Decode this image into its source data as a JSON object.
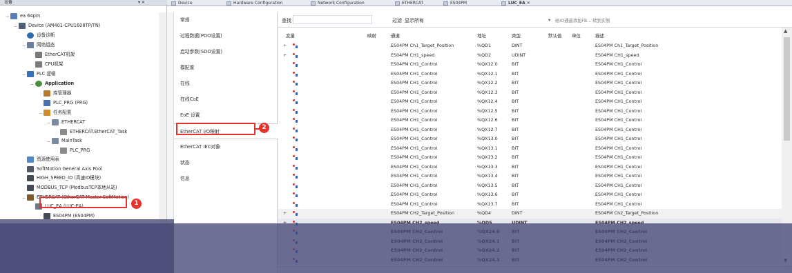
{
  "tree": {
    "header_title": "设备",
    "header_controls": "▾ ✕",
    "rows": [
      {
        "label": "ea 64pm",
        "indent": 0,
        "icon": "project-icon",
        "exp": "−",
        "bold": false
      },
      {
        "label": "Device (AM401-CPU1608TP/TN)",
        "indent": 1,
        "icon": "device-icon",
        "exp": "−",
        "bold": false
      },
      {
        "label": "设备诊断",
        "indent": 2,
        "icon": "diagnosis-icon",
        "exp": "",
        "bold": false
      },
      {
        "label": "网络组态",
        "indent": 2,
        "icon": "network-icon",
        "exp": "−",
        "bold": false
      },
      {
        "label": "EtherCAT机架",
        "indent": 3,
        "icon": "rack-icon",
        "exp": "",
        "bold": false
      },
      {
        "label": "CPU机架",
        "indent": 3,
        "icon": "rack-icon",
        "exp": "",
        "bold": false
      },
      {
        "label": "PLC 逻辑",
        "indent": 2,
        "icon": "plc-logic-icon",
        "exp": "−",
        "bold": false
      },
      {
        "label": "Application",
        "indent": 3,
        "icon": "application-icon",
        "exp": "−",
        "bold": true
      },
      {
        "label": "库管理器",
        "indent": 4,
        "icon": "library-icon",
        "exp": "",
        "bold": false
      },
      {
        "label": "PLC_PRG (PRG)",
        "indent": 4,
        "icon": "program-icon",
        "exp": "",
        "bold": false
      },
      {
        "label": "任务配置",
        "indent": 4,
        "icon": "task-config-icon",
        "exp": "−",
        "bold": false
      },
      {
        "label": "ETHERCAT",
        "indent": 5,
        "icon": "task-icon",
        "exp": "−",
        "bold": false
      },
      {
        "label": "ETHERCAT.EtherCAT_Task",
        "indent": 6,
        "icon": "task-call-icon",
        "exp": "",
        "bold": false
      },
      {
        "label": "MainTask",
        "indent": 5,
        "icon": "task-icon",
        "exp": "−",
        "bold": false
      },
      {
        "label": "PLC_PRG",
        "indent": 6,
        "icon": "task-call-icon",
        "exp": "",
        "bold": false
      },
      {
        "label": "资源使用表",
        "indent": 2,
        "icon": "resource-icon",
        "exp": "",
        "bold": false
      },
      {
        "label": "SoftMotion General Axis Pool",
        "indent": 2,
        "icon": "axis-pool-icon",
        "exp": "",
        "bold": false
      },
      {
        "label": "HIGH_SPEED_IO (高速IO模块)",
        "indent": 2,
        "icon": "module-icon",
        "exp": "",
        "bold": false
      },
      {
        "label": "MODBUS_TCP (ModbusTCP本地从站)",
        "indent": 2,
        "icon": "module-icon",
        "exp": "",
        "bold": false
      },
      {
        "label": "ETHERCAT (EtherCAT Master SoftMotion)",
        "indent": 2,
        "icon": "ethercat-master-icon",
        "exp": "−",
        "bold": false
      },
      {
        "label": "LUC_EA (LUC-EA)",
        "indent": 3,
        "icon": "slave-icon",
        "exp": "",
        "bold": false
      },
      {
        "label": "ES04PM (ES04PM)",
        "indent": 4,
        "icon": "module-icon",
        "exp": "",
        "bold": false
      }
    ]
  },
  "editor_tabs": [
    {
      "label": "Device",
      "active": false
    },
    {
      "label": "Hardware Configuration",
      "active": false
    },
    {
      "label": "Network Configuration",
      "active": false
    },
    {
      "label": "ETHERCAT",
      "active": false
    },
    {
      "label": "ES04PM",
      "active": false
    },
    {
      "label": "LUC_EA",
      "active": true
    }
  ],
  "nav": {
    "items": [
      "常规",
      "过程数据(PDO设置)",
      "启动参数(SDO设置)",
      "模配置",
      "在线",
      "在线CoE",
      "EoE 设置",
      "EtherCAT I/O映射",
      "EtherCAT IEC对象",
      "状态",
      "信息"
    ],
    "selected_index": 7
  },
  "toolbar": {
    "find_label": "查找",
    "filter_label": "过滤",
    "filter_value": "显示所有",
    "add_fb_hint": "给IO通道添加FB... 转到实例"
  },
  "columns": {
    "variable": "变量",
    "mapping": "映射",
    "channel": "通道",
    "address": "地址",
    "type": "类型",
    "default": "默认值",
    "unit": "单位",
    "description": "描述"
  },
  "rows": [
    {
      "exp": "+",
      "channel": "ES04PM Ch1_Target_Position",
      "address": "%QD1",
      "type": "DINT",
      "desc": "ES04PM Ch1_Target_Position"
    },
    {
      "exp": "+",
      "channel": "ES04PM CH1_speed",
      "address": "%QD2",
      "type": "UDINT",
      "desc": "ES04PM CH1_speed"
    },
    {
      "exp": "",
      "channel": "ES04PM CH1_Control",
      "address": "%QX12.0",
      "type": "BIT",
      "desc": "ES04PM CH1_Control"
    },
    {
      "exp": "",
      "channel": "ES04PM CH1_Control",
      "address": "%QX12.1",
      "type": "BIT",
      "desc": "ES04PM CH1_Control"
    },
    {
      "exp": "",
      "channel": "ES04PM CH1_Control",
      "address": "%QX12.2",
      "type": "BIT",
      "desc": "ES04PM CH1_Control"
    },
    {
      "exp": "",
      "channel": "ES04PM CH1_Control",
      "address": "%QX12.3",
      "type": "BIT",
      "desc": "ES04PM CH1_Control"
    },
    {
      "exp": "",
      "channel": "ES04PM CH1_Control",
      "address": "%QX12.4",
      "type": "BIT",
      "desc": "ES04PM CH1_Control"
    },
    {
      "exp": "",
      "channel": "ES04PM CH1_Control",
      "address": "%QX12.5",
      "type": "BIT",
      "desc": "ES04PM CH1_Control"
    },
    {
      "exp": "",
      "channel": "ES04PM CH1_Control",
      "address": "%QX12.6",
      "type": "BIT",
      "desc": "ES04PM CH1_Control"
    },
    {
      "exp": "",
      "channel": "ES04PM CH1_Control",
      "address": "%QX12.7",
      "type": "BIT",
      "desc": "ES04PM CH1_Control"
    },
    {
      "exp": "",
      "channel": "ES04PM CH1_Control",
      "address": "%QX13.0",
      "type": "BIT",
      "desc": "ES04PM CH1_Control"
    },
    {
      "exp": "",
      "channel": "ES04PM CH1_Control",
      "address": "%QX13.1",
      "type": "BIT",
      "desc": "ES04PM CH1_Control"
    },
    {
      "exp": "",
      "channel": "ES04PM CH1_Control",
      "address": "%QX13.2",
      "type": "BIT",
      "desc": "ES04PM CH1_Control"
    },
    {
      "exp": "",
      "channel": "ES04PM CH1_Control",
      "address": "%QX13.3",
      "type": "BIT",
      "desc": "ES04PM CH1_Control"
    },
    {
      "exp": "",
      "channel": "ES04PM CH1_Control",
      "address": "%QX13.4",
      "type": "BIT",
      "desc": "ES04PM CH1_Control"
    },
    {
      "exp": "",
      "channel": "ES04PM CH1_Control",
      "address": "%QX13.5",
      "type": "BIT",
      "desc": "ES04PM CH1_Control"
    },
    {
      "exp": "",
      "channel": "ES04PM CH1_Control",
      "address": "%QX13.6",
      "type": "BIT",
      "desc": "ES04PM CH1_Control"
    },
    {
      "exp": "",
      "channel": "ES04PM CH1_Control",
      "address": "%QX13.7",
      "type": "BIT",
      "desc": "ES04PM CH1_Control"
    },
    {
      "exp": "+",
      "channel": "ES04PM CH2_Target_Position",
      "address": "%QD4",
      "type": "DINT",
      "desc": "ES04PM Ch2_Target_Position"
    },
    {
      "exp": "+",
      "channel": "ES04PM CH2_speed",
      "address": "%QD5",
      "type": "UDINT",
      "desc": "ES04PM CH2_speed"
    },
    {
      "exp": "",
      "channel": "ES04PM CH2_Control",
      "address": "%QX24.0",
      "type": "BIT",
      "desc": "ES04PM CH2_Control"
    },
    {
      "exp": "",
      "channel": "ES04PM CH2_Control",
      "address": "%QX24.1",
      "type": "BIT",
      "desc": "ES04PM CH2_Control"
    },
    {
      "exp": "",
      "channel": "ES04PM CH2_Control",
      "address": "%QX24.2",
      "type": "BIT",
      "desc": "ES04PM CH2_Control"
    },
    {
      "exp": "",
      "channel": "ES04PM CH2_Control",
      "address": "%QX24.3",
      "type": "BIT",
      "desc": "ES04PM CH2_Control"
    }
  ],
  "annotations": {
    "badge_1": "1",
    "badge_2": "2"
  },
  "colors": {
    "annotation_red": "#e5322d",
    "overlay": "#464876"
  }
}
